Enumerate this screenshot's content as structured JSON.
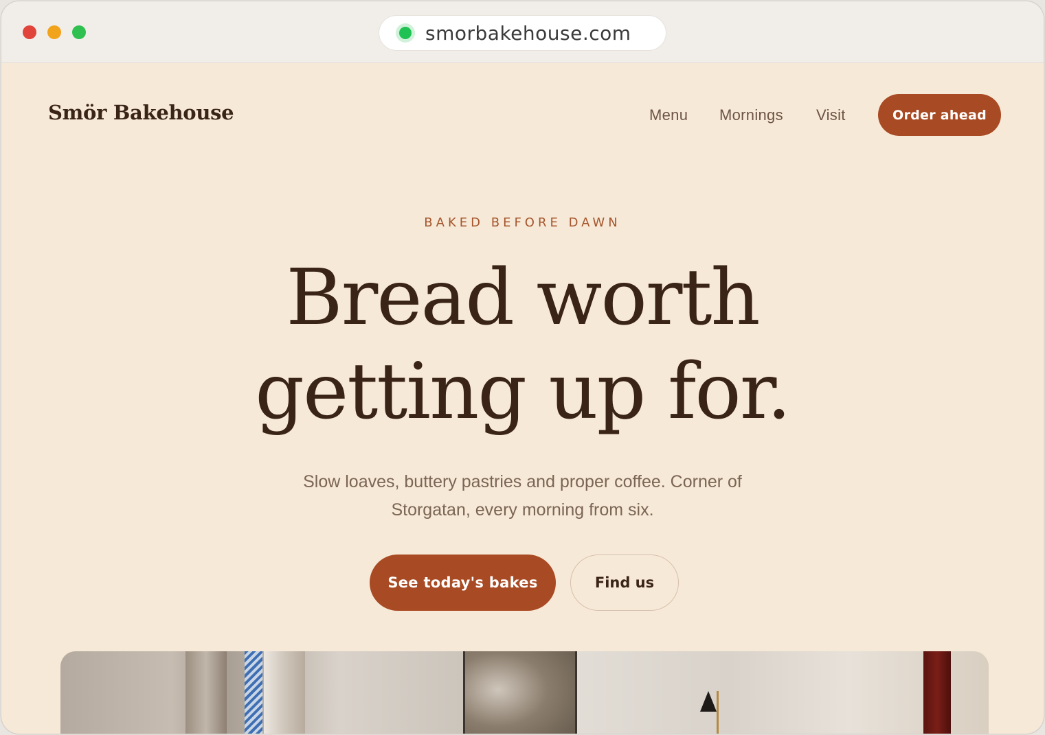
{
  "browser": {
    "url": "smorbakehouse.com"
  },
  "header": {
    "logo": "Smör Bakehouse",
    "nav": [
      "Menu",
      "Mornings",
      "Visit"
    ],
    "order_button": "Order ahead"
  },
  "hero": {
    "eyebrow": "BAKED BEFORE DAWN",
    "headline_line1": "Bread worth",
    "headline_line2": "getting up for.",
    "subtext": "Slow loaves, buttery pastries and proper coffee. Corner of Storgatan, every morning from six.",
    "primary_cta": "See today's bakes",
    "secondary_cta": "Find us"
  },
  "colors": {
    "page_background": "#f7e9d7",
    "accent": "#a84a23",
    "text_dark": "#3a2417",
    "text_muted": "#7b6554"
  },
  "icons": [
    "window-close-dot",
    "window-minimize-dot",
    "window-zoom-dot",
    "secure-site-icon"
  ]
}
